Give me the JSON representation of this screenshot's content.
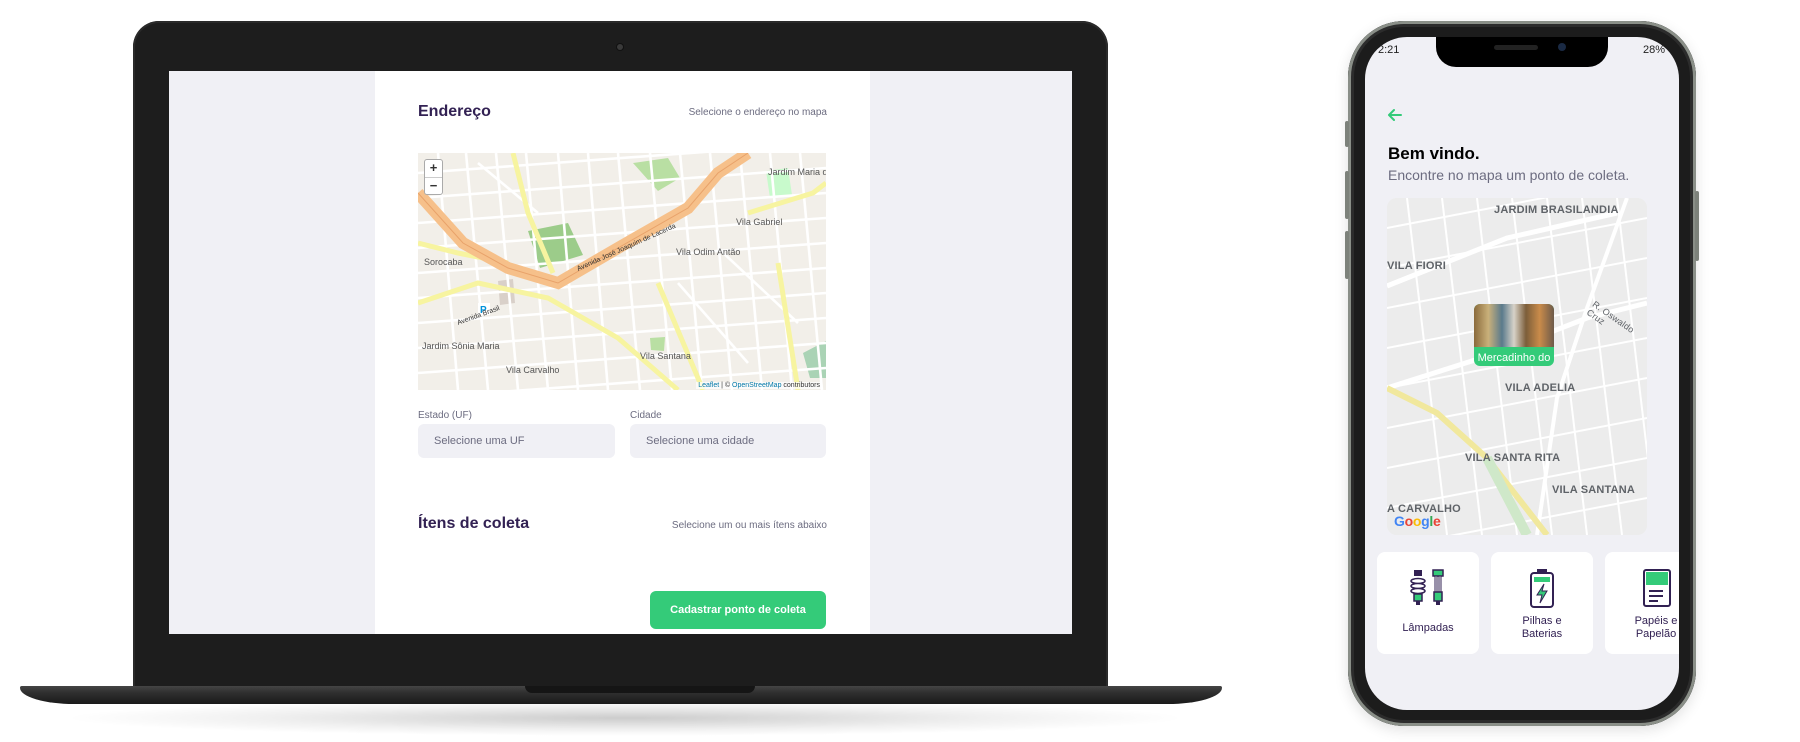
{
  "web": {
    "address": {
      "title": "Endereço",
      "hint": "Selecione o endereço no mapa"
    },
    "map": {
      "zoom_in": "+",
      "zoom_out": "−",
      "attr_leaflet": "Leaflet",
      "attr_sep": " | © ",
      "attr_osm": "OpenStreetMap",
      "attr_contrib": " contributors",
      "labels": [
        "Jardim Maria do Carmo",
        "Vila Gabriel",
        "Vila Odim Antão",
        "Sorocaba",
        "Jardim Sônia Maria",
        "Vila Carvalho",
        "Vila Santana",
        "Avenida José Joaquim de Lacerda",
        "Avenida Brasil"
      ]
    },
    "uf": {
      "label": "Estado (UF)",
      "placeholder": "Selecione uma UF"
    },
    "city": {
      "label": "Cidade",
      "placeholder": "Selecione uma cidade"
    },
    "items": {
      "title": "Ítens de coleta",
      "hint": "Selecione um ou mais ítens abaixo"
    },
    "submit": "Cadastrar ponto de coleta"
  },
  "phone": {
    "status": {
      "time": "2:21",
      "battery": "28%"
    },
    "welcome": "Bem vindo.",
    "subtitle": "Encontre no mapa um ponto de coleta.",
    "map_labels": [
      "JARDIM BRASILANDIA",
      "VILA FIORI",
      "R. Oswaldo Cruz",
      "VILA ADELIA",
      "VILA SANTA RITA",
      "VILA SANTANA",
      "A CARVALHO"
    ],
    "pin_label": "Mercadinho do",
    "google": [
      "G",
      "o",
      "o",
      "g",
      "l",
      "e"
    ],
    "items": [
      {
        "line1": "Lâmpadas",
        "line2": ""
      },
      {
        "line1": "Pilhas e",
        "line2": "Baterias"
      },
      {
        "line1": "Papéis e",
        "line2": "Papelão"
      }
    ]
  },
  "colors": {
    "accent": "#34cb79",
    "title": "#322153",
    "muted": "#6c6c80",
    "page_bg": "#f0f0f5"
  },
  "icons": [
    "back-arrow-icon",
    "lamp-icon",
    "battery-icon",
    "paper-icon",
    "map-pin-icon"
  ]
}
